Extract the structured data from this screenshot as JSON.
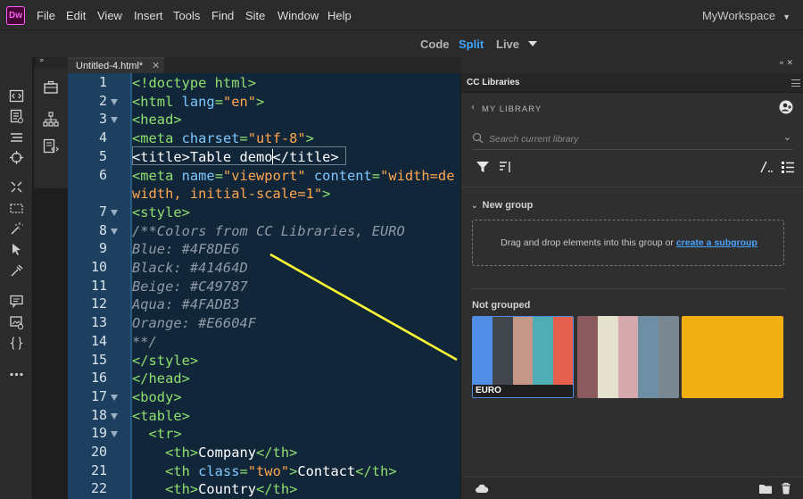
{
  "app": {
    "logo_text": "Dw",
    "workspace": "MyWorkspace"
  },
  "menu": {
    "items": [
      "File",
      "Edit",
      "View",
      "Insert",
      "Tools",
      "Find",
      "Site",
      "Window",
      "Help"
    ]
  },
  "modes": {
    "code": "Code",
    "split": "Split",
    "live": "Live",
    "active": "Split"
  },
  "toolbar": {
    "icons": [
      "code-view-icon",
      "document-icon",
      "list-icon",
      "target-icon",
      "expand-icon",
      "select-box-icon",
      "magic-wand-icon",
      "pointer-icon",
      "eyedropper-icon",
      "comment-icon",
      "image-check-icon",
      "braces-icon",
      "more-icon"
    ]
  },
  "document": {
    "tab_label": "Untitled-4.html*",
    "close_glyph": "✕"
  },
  "editor": {
    "line_numbers": [
      "1",
      "2",
      "3",
      "4",
      "5",
      "6",
      "",
      "7",
      "8",
      "9",
      "10",
      "11",
      "12",
      "13",
      "14",
      "15",
      "16",
      "17",
      "18",
      "19",
      "20",
      "21",
      "22"
    ],
    "folds": [
      "2",
      "3",
      "7",
      "8",
      "17",
      "18",
      "19"
    ],
    "lines": [
      [
        {
          "t": "tag",
          "v": "<!doctype html>"
        }
      ],
      [
        {
          "t": "tag",
          "v": "<html "
        },
        {
          "t": "attr",
          "v": "lang"
        },
        {
          "t": "tag",
          "v": "="
        },
        {
          "t": "val",
          "v": "\"en\""
        },
        {
          "t": "tag",
          "v": ">"
        }
      ],
      [
        {
          "t": "tag",
          "v": "<head>"
        }
      ],
      [
        {
          "t": "tag",
          "v": "<meta "
        },
        {
          "t": "attr",
          "v": "charset"
        },
        {
          "t": "tag",
          "v": "="
        },
        {
          "t": "val",
          "v": "\"utf-8\""
        },
        {
          "t": "tag",
          "v": ">"
        }
      ],
      [
        {
          "t": "txt",
          "v": "<title>Table demo"
        },
        {
          "t": "caret",
          "v": ""
        },
        {
          "t": "txt",
          "v": "</title>"
        }
      ],
      [
        {
          "t": "tag",
          "v": "<meta "
        },
        {
          "t": "attr",
          "v": "name"
        },
        {
          "t": "tag",
          "v": "="
        },
        {
          "t": "val",
          "v": "\"viewport\" "
        },
        {
          "t": "attr",
          "v": "content"
        },
        {
          "t": "tag",
          "v": "="
        },
        {
          "t": "val",
          "v": "\"width=de"
        }
      ],
      [
        {
          "t": "val",
          "v": "width, initial-scale=1\""
        },
        {
          "t": "tag",
          "v": ">"
        }
      ],
      [
        {
          "t": "tag",
          "v": "<style>"
        }
      ],
      [
        {
          "t": "cm",
          "v": "/**Colors from CC Libraries, EURO"
        }
      ],
      [
        {
          "t": "cm",
          "v": "Blue: #4F8DE6"
        }
      ],
      [
        {
          "t": "cm",
          "v": "Black: #41464D"
        }
      ],
      [
        {
          "t": "cm",
          "v": "Beige: #C49787"
        }
      ],
      [
        {
          "t": "cm",
          "v": "Aqua: #4FADB3"
        }
      ],
      [
        {
          "t": "cm",
          "v": "Orange: #E6604F"
        }
      ],
      [
        {
          "t": "cm",
          "v": "**/"
        }
      ],
      [
        {
          "t": "tag",
          "v": "</style>"
        }
      ],
      [
        {
          "t": "tag",
          "v": "</head>"
        }
      ],
      [
        {
          "t": "tag",
          "v": "<body>"
        }
      ],
      [
        {
          "t": "tag",
          "v": "<table>"
        }
      ],
      [
        {
          "t": "tag",
          "v": "  <tr>"
        }
      ],
      [
        {
          "t": "tag",
          "v": "    <th>"
        },
        {
          "t": "txt",
          "v": "Company"
        },
        {
          "t": "tag",
          "v": "</th>"
        }
      ],
      [
        {
          "t": "tag",
          "v": "    <th "
        },
        {
          "t": "attr",
          "v": "class"
        },
        {
          "t": "tag",
          "v": "="
        },
        {
          "t": "val",
          "v": "\"two\""
        },
        {
          "t": "tag",
          "v": ">"
        },
        {
          "t": "txt",
          "v": "Contact"
        },
        {
          "t": "tag",
          "v": "</th>"
        }
      ],
      [
        {
          "t": "tag",
          "v": "    <th>"
        },
        {
          "t": "txt",
          "v": "Country"
        },
        {
          "t": "tag",
          "v": "</th>"
        }
      ]
    ]
  },
  "panel": {
    "tab_label": "CC Libraries",
    "library_name": "MY LIBRARY",
    "search_placeholder": "Search current library",
    "group_name": "New group",
    "dropzone_text": "Drag and drop elements into this group or ",
    "dropzone_link": "create a subgroup",
    "ungrouped_label": "Not grouped",
    "swatches": [
      {
        "label": "EURO",
        "selected": true,
        "colors": [
          "#4F8DE6",
          "#41464D",
          "#C49787",
          "#4FADB3",
          "#E6604F"
        ]
      },
      {
        "label": "",
        "selected": false,
        "colors": [
          "#8A5A5E",
          "#E4E2CF",
          "#D6A9AE",
          "#6E8EA6",
          "#7A8790"
        ]
      },
      {
        "label": "",
        "selected": false,
        "colors": [
          "#F2AF12"
        ]
      }
    ]
  },
  "colors": {
    "accent": "#3ea6ff",
    "annotation": "#ffff33",
    "editor_bg": "#12263a"
  }
}
